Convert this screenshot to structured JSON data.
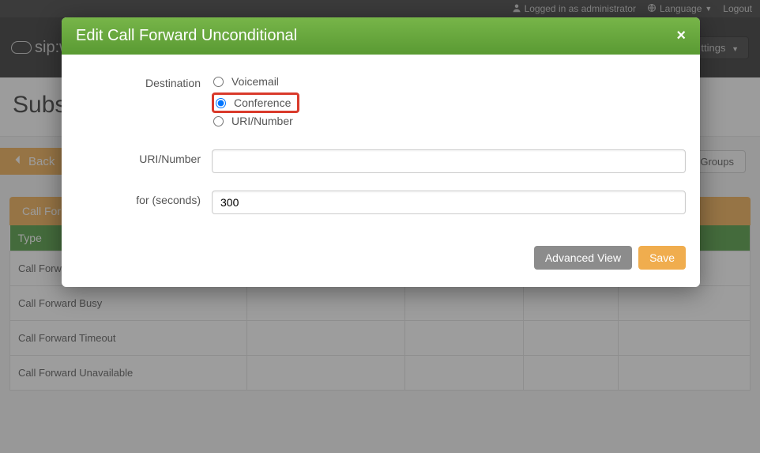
{
  "topbar": {
    "logged_in": "Logged in as administrator",
    "language": "Language",
    "logout": "Logout"
  },
  "navbar": {
    "brand": "sip:wise",
    "settings": "ttings"
  },
  "page": {
    "title_partial": "Subsc"
  },
  "back": {
    "label": "Back"
  },
  "toolbar": {
    "groups_partial": "d Groups"
  },
  "panel": {
    "tab_partial": "Call For"
  },
  "table": {
    "header_type": "Type",
    "rows": [
      {
        "label": "Call Forward Unconditional"
      },
      {
        "label": "Call Forward Busy"
      },
      {
        "label": "Call Forward Timeout"
      },
      {
        "label": "Call Forward Unavailable"
      }
    ]
  },
  "modal": {
    "title": "Edit Call Forward Unconditional",
    "close": "×",
    "destination_label": "Destination",
    "options": {
      "voicemail": "Voicemail",
      "conference": "Conference",
      "uri": "URI/Number"
    },
    "selected": "conference",
    "uri_label": "URI/Number",
    "uri_value": "",
    "for_label": "for (seconds)",
    "for_value": "300",
    "advanced_btn": "Advanced View",
    "save_btn": "Save"
  }
}
